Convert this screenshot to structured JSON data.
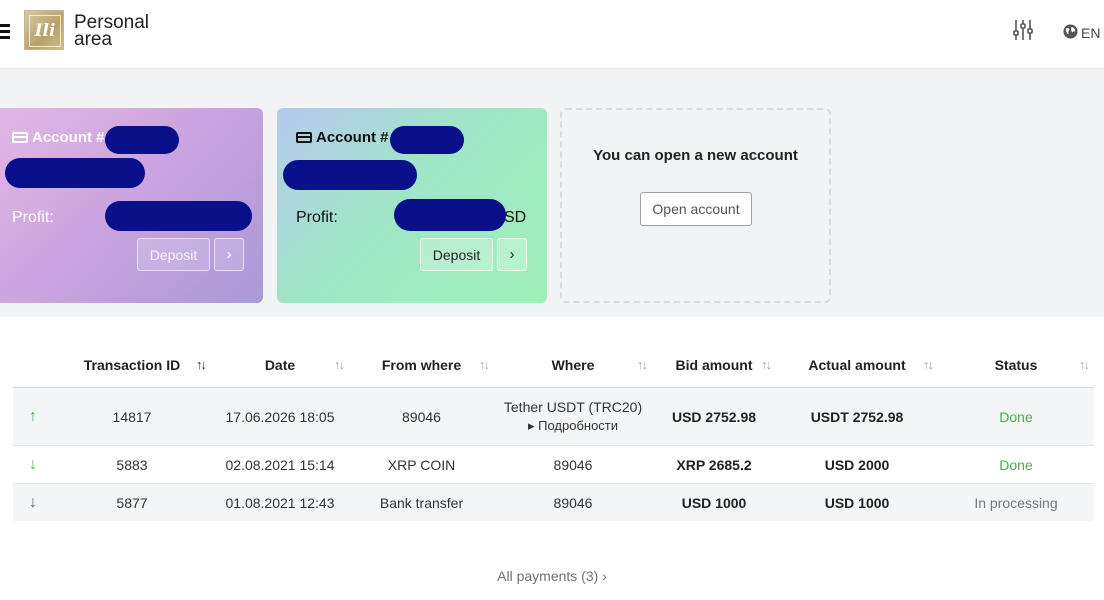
{
  "header": {
    "brand_line1": "Personal",
    "brand_line2": "area",
    "logo_text": "Ili",
    "language": "EN"
  },
  "accounts": [
    {
      "title": "Account #",
      "profit_label": "Profit:",
      "currency_suffix": "",
      "deposit_label": "Deposit",
      "next_label": "›"
    },
    {
      "title": "Account #",
      "profit_label": "Profit:",
      "currency_suffix": "SD",
      "deposit_label": "Deposit",
      "next_label": "›"
    }
  ],
  "new_account": {
    "text": "You can open a new account",
    "button_label": "Open account"
  },
  "table": {
    "columns": [
      "Transaction ID",
      "Date",
      "From where",
      "Where",
      "Bid amount",
      "Actual amount",
      "Status"
    ],
    "rows": [
      {
        "direction": "↑",
        "id": "14817",
        "date": "17.06.2026 18:05",
        "from": "89046",
        "where": "Tether USDT (TRC20)",
        "where_details": "▸ Подробности",
        "bid": "USD 2752.98",
        "actual": "USDT 2752.98",
        "status": "Done"
      },
      {
        "direction": "↓",
        "id": "5883",
        "date": "02.08.2021 15:14",
        "from": "XRP COIN",
        "where": "89046",
        "bid": "XRP 2685.2",
        "actual": "USD 2000",
        "status": "Done"
      },
      {
        "direction": "↓",
        "id": "5877",
        "date": "01.08.2021 12:43",
        "from": "Bank transfer",
        "where": "89046",
        "bid": "USD 1000",
        "actual": "USD 1000",
        "status": "In processing"
      }
    ]
  },
  "footer": {
    "all_payments": "All payments (3) ›"
  },
  "colors": {
    "done": "#4caf50",
    "up_arrow": "#4caf50",
    "down_arrow_done": "#4caf50",
    "down_arrow_processing": "#666666",
    "redaction": "#0a0f8a"
  }
}
